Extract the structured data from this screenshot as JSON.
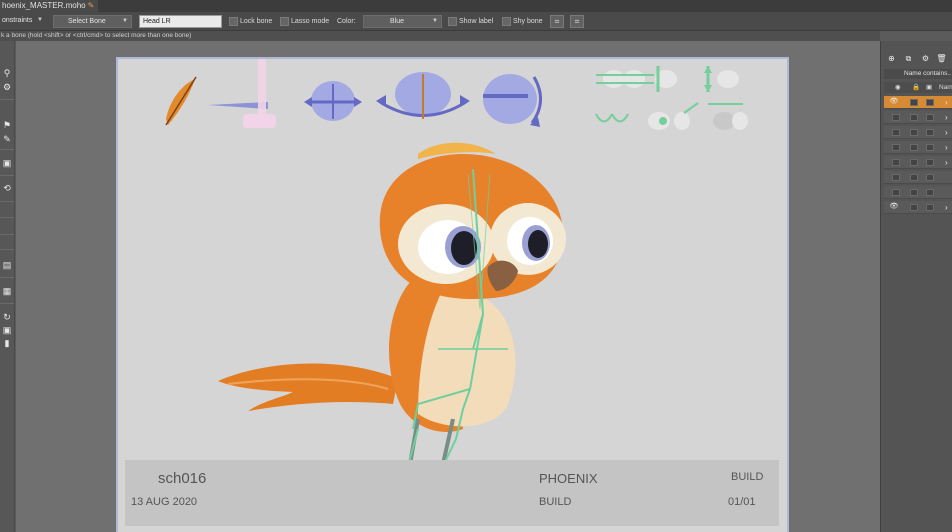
{
  "window": {
    "tab_title": "hoenix_MASTER.moho"
  },
  "toolbar": {
    "constraints_label": "onstraints",
    "select_bone_value": "Select Bone",
    "bone_name_value": "Head LR",
    "lock_bone_label": "Lock bone",
    "lasso_mode_label": "Lasso mode",
    "color_label": "Color:",
    "color_value": "Blue",
    "show_label_label": "Show label",
    "shy_bone_label": "Shy bone"
  },
  "status_text": "k a bone (hold <shift> or <ctrl/cmd> to select more than one bone)",
  "footer": {
    "scene": "sch016",
    "date": "13 AUG 2020",
    "project": "PHOENIX",
    "phase_top": "BUILD",
    "phase_bottom": "BUILD",
    "page": "01/01"
  },
  "layers_panel": {
    "search_placeholder": "Name contains..",
    "name_column": "Nam",
    "rows": [
      {
        "state": "selected",
        "eye": true
      },
      {
        "state": "normal",
        "eye": false
      },
      {
        "state": "normal",
        "eye": false
      },
      {
        "state": "normal",
        "eye": false
      },
      {
        "state": "normal",
        "eye": false
      },
      {
        "state": "normal",
        "eye": false
      },
      {
        "state": "normal",
        "eye": false
      },
      {
        "state": "normal",
        "eye": true
      }
    ]
  },
  "colors": {
    "accent_selected": "#d58a33",
    "bird_orange": "#e8822a",
    "bone_green": "#6dcfa0",
    "control_blue": "#8a8fd8"
  }
}
